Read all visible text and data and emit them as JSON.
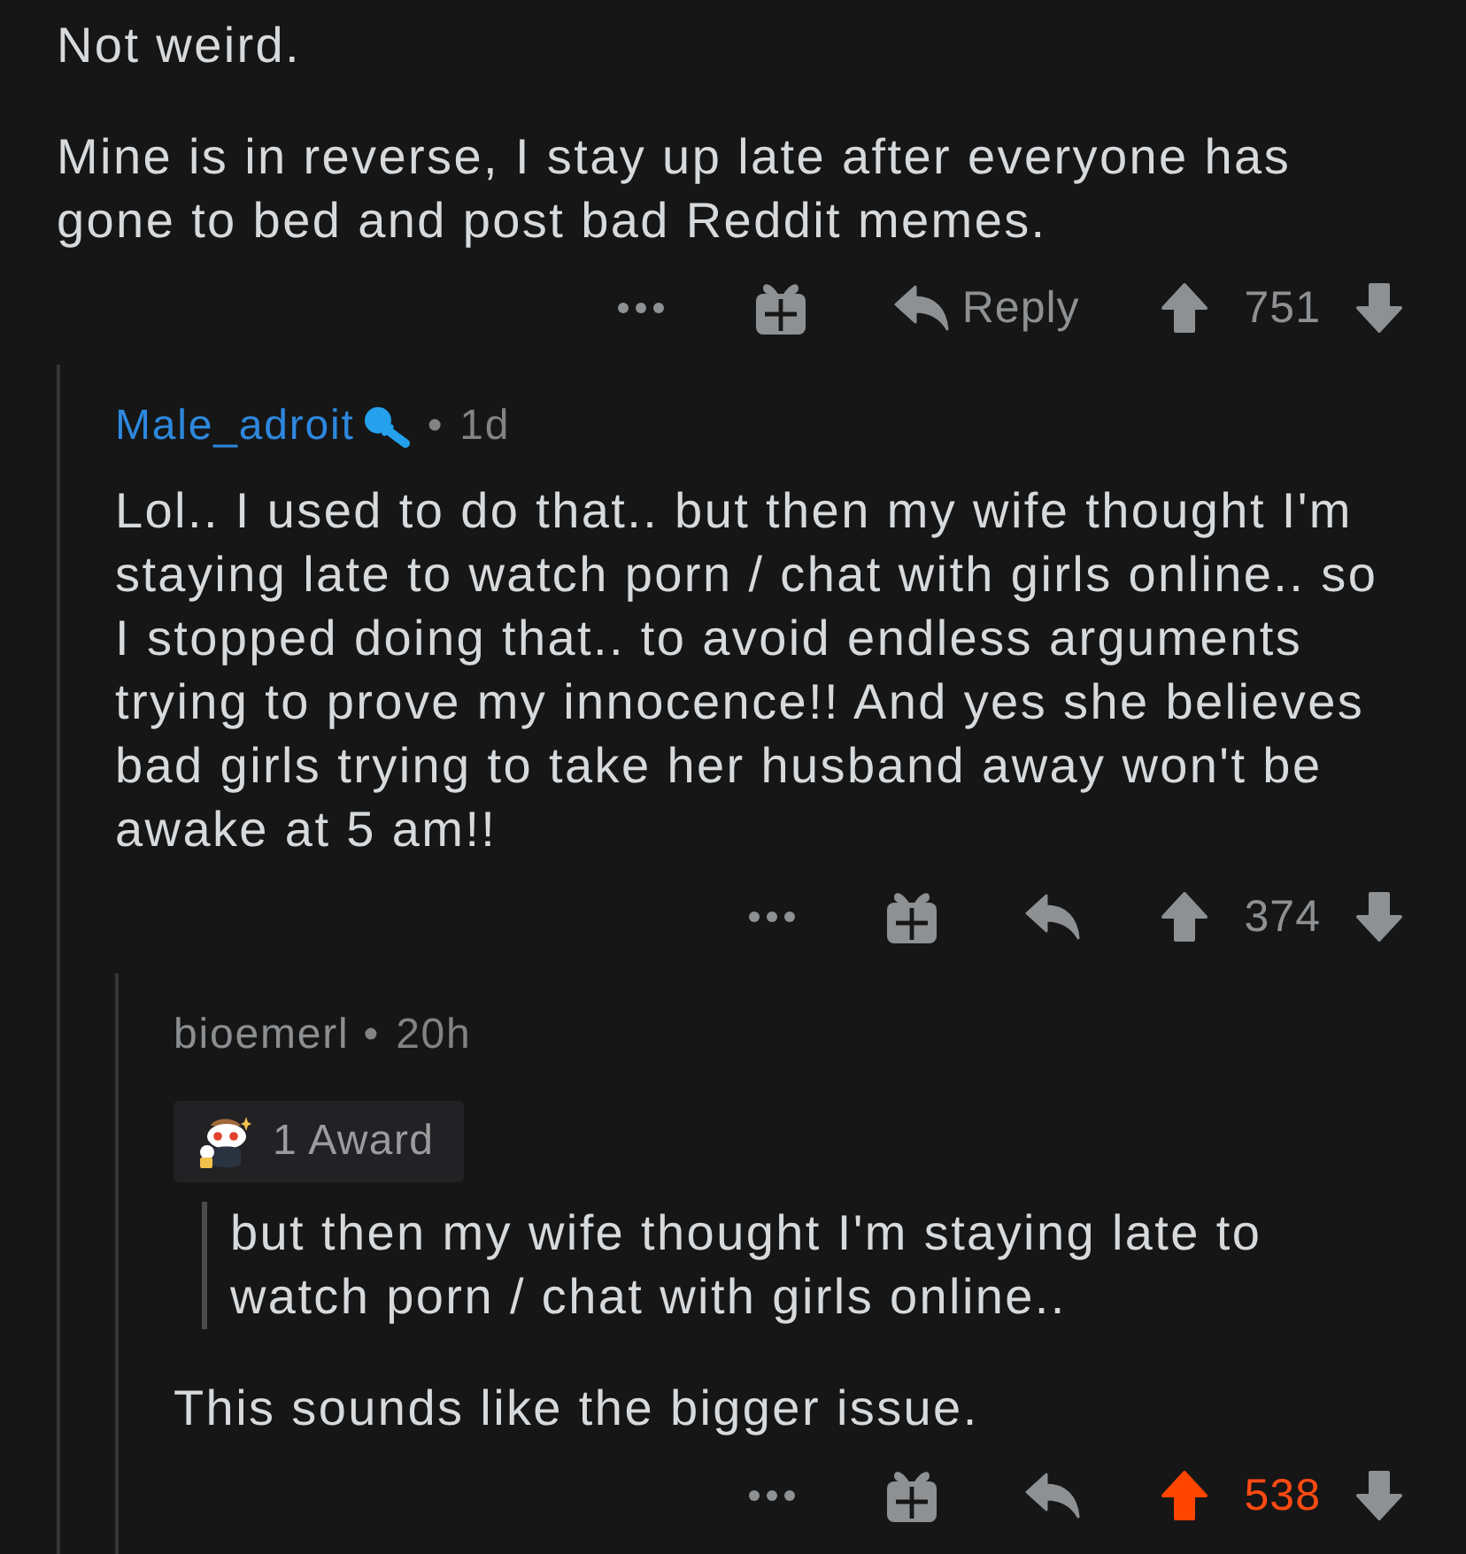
{
  "thread": {
    "body": [
      {
        "kind": "text",
        "text": "Not weird."
      },
      {
        "kind": "text",
        "text": "Mine is in reverse, I stay up late after everyone has gone to bed and post bad Reddit memes."
      }
    ],
    "actions": {
      "reply_label": "Reply",
      "score": "751",
      "upvoted": false,
      "downvoted": false
    },
    "replies": [
      {
        "author": "Male_adroit",
        "op": true,
        "flair_icon": true,
        "separator": "•",
        "age": "1d",
        "body": [
          {
            "kind": "text",
            "text": "Lol.. I used to do that.. but then my wife thought I'm staying late to watch porn / chat with girls online.. so I stopped doing that.. to avoid endless arguments trying to prove my innocence!! And yes she believes bad girls trying to take her husband away won't be awake at 5 am!!"
          }
        ],
        "actions": {
          "score": "374",
          "upvoted": false,
          "downvoted": false
        },
        "replies": [
          {
            "author": "bioemerl",
            "op": false,
            "flair_icon": false,
            "separator": "•",
            "age": "20h",
            "award_label": "1 Award",
            "body": [
              {
                "kind": "quote",
                "text": "but then my wife thought I'm staying late to watch porn / chat with girls online.."
              },
              {
                "kind": "text",
                "text": "This sounds like the bigger issue."
              }
            ],
            "actions": {
              "score": "538",
              "upvoted": true,
              "downvoted": false
            }
          }
        ]
      }
    ]
  }
}
